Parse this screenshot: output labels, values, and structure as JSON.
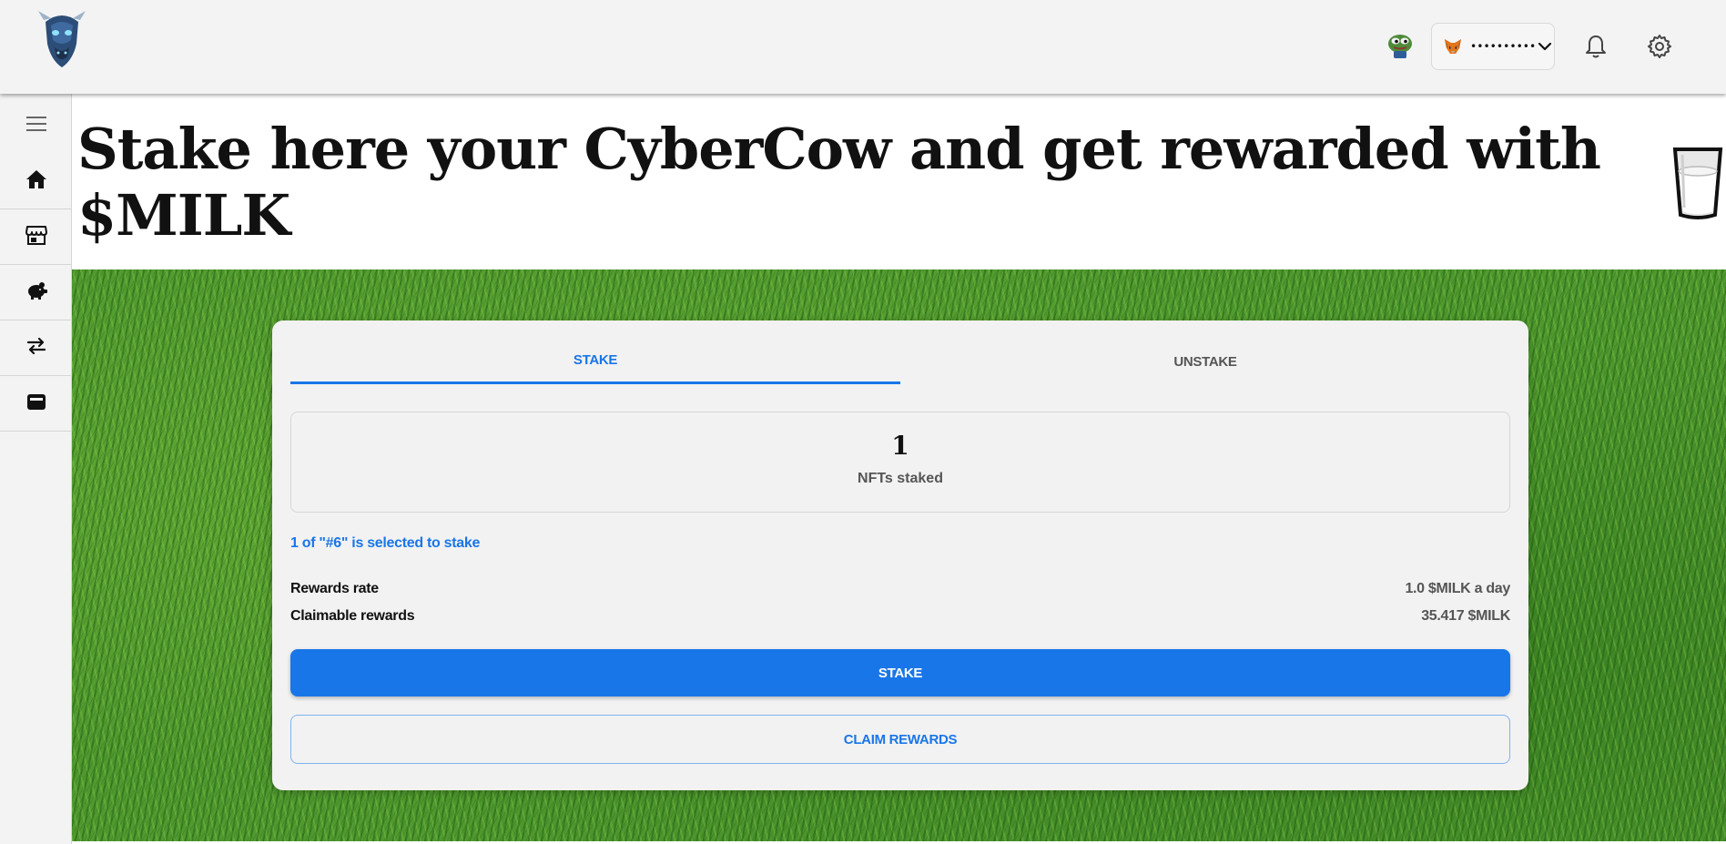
{
  "topbar": {
    "logo_icon": "cybercow-logo",
    "avatar_icon": "pepe-avatar",
    "wallet": {
      "icon": "metamask-fox-icon",
      "address": "••••••••••",
      "dropdown_icon": "chevron-down-icon"
    },
    "notifications_icon": "bell-icon",
    "settings_icon": "gear-icon"
  },
  "sidebar": {
    "items": [
      {
        "icon": "hamburger-menu-icon"
      },
      {
        "icon": "home-icon"
      },
      {
        "icon": "store-icon"
      },
      {
        "icon": "piggy-bank-icon"
      },
      {
        "icon": "swap-arrows-icon"
      },
      {
        "icon": "wallet-icon"
      }
    ]
  },
  "banner": {
    "title": "Stake here your CyberCow and get rewarded with $MILK",
    "emoji_icon": "milk-glass-icon"
  },
  "card": {
    "tabs": [
      {
        "label": "STAKE",
        "active": true
      },
      {
        "label": "UNSTAKE",
        "active": false
      }
    ],
    "stats": {
      "count": "1",
      "label": "NFTs staked"
    },
    "selection_note": "1 of \"#6\" is selected to stake",
    "rewards_rate": {
      "label": "Rewards rate",
      "value": "1.0 $MILK a day"
    },
    "claimable_rewards": {
      "label": "Claimable rewards",
      "value": "35.417 $MILK"
    },
    "stake_button": "STAKE",
    "claim_button": "CLAIM REWARDS"
  },
  "colors": {
    "accent": "#1976e8",
    "topbar_bg": "#f3f3f3",
    "card_bg": "#f2f2f2",
    "grass": "#4f9a2f"
  }
}
